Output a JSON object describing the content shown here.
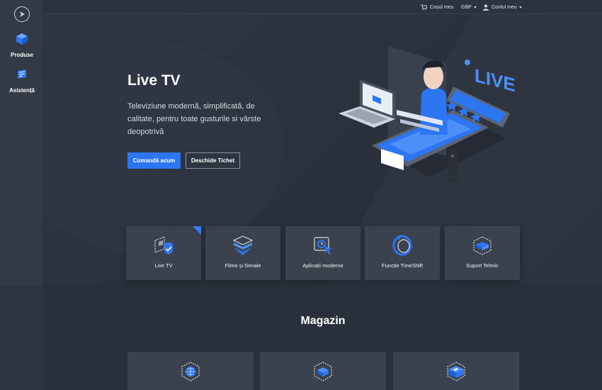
{
  "sidebar": {
    "logo_icon": "play-logo-icon",
    "items": [
      {
        "label": "Produse",
        "icon": "box-icon"
      },
      {
        "label": "Asistență",
        "icon": "support-icon"
      }
    ]
  },
  "topbar": {
    "cart_label": "Coșul meu",
    "currency_label": "GBP",
    "account_label": "Contul meu"
  },
  "hero": {
    "title": "Live TV",
    "subtitle": "Televiziune modernă, simplificată, de calitate, pentru toate gusturile si vârste deopotrivă",
    "primary_button": "Comandă acum",
    "secondary_button": "Deschide Tichet",
    "illustration_text": "LIVE"
  },
  "features": [
    {
      "label": "Live TV",
      "icon": "live-tv-icon",
      "selected": true
    },
    {
      "label": "Filme și Seriale",
      "icon": "layers-icon",
      "selected": false
    },
    {
      "label": "Aplicații moderne",
      "icon": "apps-icon",
      "selected": false
    },
    {
      "label": "Funcție TimeShift",
      "icon": "timeshift-icon",
      "selected": false
    },
    {
      "label": "Suport Tehnic",
      "icon": "support-box-icon",
      "selected": false
    }
  ],
  "shop": {
    "title": "Magazin",
    "items": [
      {
        "icon": "globe-cube-icon"
      },
      {
        "icon": "stack-cube-icon"
      },
      {
        "icon": "tag-cube-icon"
      }
    ]
  },
  "colors": {
    "accent": "#2d76f2",
    "background": "#2a303b",
    "card": "#3b424e",
    "sidebar": "#333a46"
  }
}
